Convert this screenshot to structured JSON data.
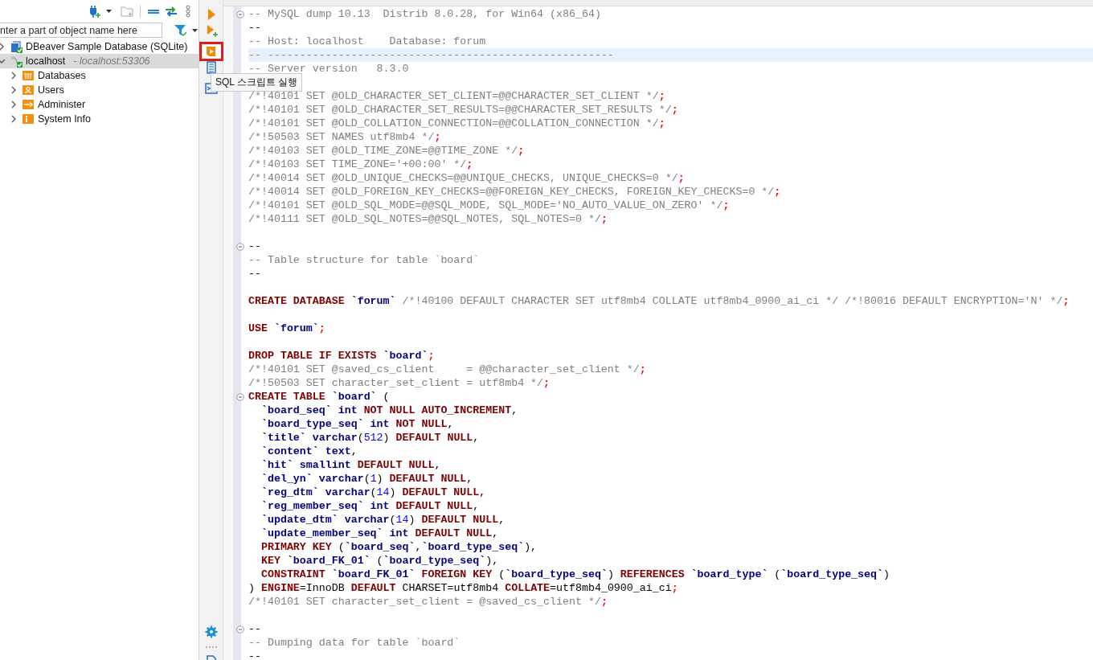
{
  "navigator": {
    "filter": {
      "placeholder": "nter a part of object name here"
    },
    "tree": [
      {
        "label": "DBeaver Sample Database (SQLite)",
        "kind": "database",
        "expanded": false,
        "selected": false
      },
      {
        "label": "localhost",
        "detail": "- localhost:53306",
        "kind": "connection",
        "expanded": true,
        "selected": true,
        "children": [
          {
            "label": "Databases",
            "kind": "databases",
            "expanded": false,
            "selected": false
          },
          {
            "label": "Users",
            "kind": "users",
            "expanded": false,
            "selected": false
          },
          {
            "label": "Administer",
            "kind": "admin",
            "expanded": false,
            "selected": false
          },
          {
            "label": "System Info",
            "kind": "info",
            "expanded": false,
            "selected": false
          }
        ]
      }
    ]
  },
  "editor_toolbar": [
    {
      "kind": "run",
      "highlighted": false
    },
    {
      "kind": "run-new",
      "highlighted": false
    },
    {
      "kind": "script",
      "highlighted": true
    },
    {
      "kind": "explain",
      "highlighted": false
    },
    {
      "kind": "terminal",
      "highlighted": false
    }
  ],
  "tooltip": {
    "text": "SQL 스크립트 실행"
  },
  "editor": {
    "lines": [
      {
        "fold": true,
        "tokens": [
          {
            "kind": "comment",
            "text": "-- MySQL dump 10.13  Distrib 8.0.28, for Win64 (x86_64)"
          }
        ]
      },
      {
        "tokens": [
          {
            "kind": "plain",
            "text": "--"
          }
        ]
      },
      {
        "tokens": [
          {
            "kind": "comment",
            "text": "-- Host: localhost    Database: forum"
          }
        ]
      },
      {
        "current": true,
        "tokens": [
          {
            "kind": "comment",
            "text": "-- ------------------------------------------------------"
          }
        ]
      },
      {
        "tokens": [
          {
            "kind": "comment",
            "text": "-- Server version   8.3.0"
          }
        ]
      },
      {
        "kind": "blank"
      },
      {
        "tokens": [
          {
            "kind": "comment",
            "text": "/*!40101 SET @OLD_CHARACTER_SET_CLIENT=@@CHARACTER_SET_CLIENT */"
          },
          {
            "kind": "semicolon",
            "text": ";"
          }
        ]
      },
      {
        "tokens": [
          {
            "kind": "comment",
            "text": "/*!40101 SET @OLD_CHARACTER_SET_RESULTS=@@CHARACTER_SET_RESULTS */"
          },
          {
            "kind": "semicolon",
            "text": ";"
          }
        ]
      },
      {
        "tokens": [
          {
            "kind": "comment",
            "text": "/*!40101 SET @OLD_COLLATION_CONNECTION=@@COLLATION_CONNECTION */"
          },
          {
            "kind": "semicolon",
            "text": ";"
          }
        ]
      },
      {
        "tokens": [
          {
            "kind": "comment",
            "text": "/*!50503 SET NAMES utf8mb4 */"
          },
          {
            "kind": "semicolon",
            "text": ";"
          }
        ]
      },
      {
        "tokens": [
          {
            "kind": "comment",
            "text": "/*!40103 SET @OLD_TIME_ZONE=@@TIME_ZONE */"
          },
          {
            "kind": "semicolon",
            "text": ";"
          }
        ]
      },
      {
        "tokens": [
          {
            "kind": "comment",
            "text": "/*!40103 SET TIME_ZONE='+00:00' */"
          },
          {
            "kind": "semicolon",
            "text": ";"
          }
        ]
      },
      {
        "tokens": [
          {
            "kind": "comment",
            "text": "/*!40014 SET @OLD_UNIQUE_CHECKS=@@UNIQUE_CHECKS, UNIQUE_CHECKS=0 */"
          },
          {
            "kind": "semicolon",
            "text": ";"
          }
        ]
      },
      {
        "tokens": [
          {
            "kind": "comment",
            "text": "/*!40014 SET @OLD_FOREIGN_KEY_CHECKS=@@FOREIGN_KEY_CHECKS, FOREIGN_KEY_CHECKS=0 */"
          },
          {
            "kind": "semicolon",
            "text": ";"
          }
        ]
      },
      {
        "tokens": [
          {
            "kind": "comment",
            "text": "/*!40101 SET @OLD_SQL_MODE=@@SQL_MODE, SQL_MODE='NO_AUTO_VALUE_ON_ZERO' */"
          },
          {
            "kind": "semicolon",
            "text": ";"
          }
        ]
      },
      {
        "tokens": [
          {
            "kind": "comment",
            "text": "/*!40111 SET @OLD_SQL_NOTES=@@SQL_NOTES, SQL_NOTES=0 */"
          },
          {
            "kind": "semicolon",
            "text": ";"
          }
        ]
      },
      {
        "kind": "blank"
      },
      {
        "fold": true,
        "tokens": [
          {
            "kind": "plain",
            "text": "--"
          }
        ]
      },
      {
        "tokens": [
          {
            "kind": "comment",
            "text": "-- Table structure for table `board`"
          }
        ]
      },
      {
        "tokens": [
          {
            "kind": "plain",
            "text": "--"
          }
        ]
      },
      {
        "kind": "blank"
      },
      {
        "tokens": [
          {
            "kind": "keyword",
            "text": "CREATE DATABASE "
          },
          {
            "kind": "name",
            "text": "`forum` "
          },
          {
            "kind": "comment",
            "text": "/*!40100 DEFAULT CHARACTER SET utf8mb4 COLLATE utf8mb4_0900_ai_ci */ /*!80016 DEFAULT ENCRYPTION='N' */"
          },
          {
            "kind": "semicolon",
            "text": ";"
          }
        ]
      },
      {
        "kind": "blank"
      },
      {
        "tokens": [
          {
            "kind": "keyword",
            "text": "USE "
          },
          {
            "kind": "name",
            "text": "`forum`"
          },
          {
            "kind": "semicolon",
            "text": ";"
          }
        ]
      },
      {
        "kind": "blank"
      },
      {
        "tokens": [
          {
            "kind": "keyword",
            "text": "DROP TABLE IF EXISTS "
          },
          {
            "kind": "name",
            "text": "`board`"
          },
          {
            "kind": "semicolon",
            "text": ";"
          }
        ]
      },
      {
        "tokens": [
          {
            "kind": "comment",
            "text": "/*!40101 SET @saved_cs_client     = @@character_set_client */"
          },
          {
            "kind": "semicolon",
            "text": ";"
          }
        ]
      },
      {
        "tokens": [
          {
            "kind": "comment",
            "text": "/*!50503 SET character_set_client = utf8mb4 */"
          },
          {
            "kind": "semicolon",
            "text": ";"
          }
        ]
      },
      {
        "fold": true,
        "tokens": [
          {
            "kind": "keyword",
            "text": "CREATE TABLE "
          },
          {
            "kind": "name",
            "text": "`board` "
          },
          {
            "kind": "plain",
            "text": "("
          }
        ]
      },
      {
        "tokens": [
          {
            "kind": "name",
            "text": "  `board_seq` int "
          },
          {
            "kind": "keyword",
            "text": "NOT NULL AUTO_INCREMENT"
          },
          {
            "kind": "plain",
            "text": ","
          }
        ]
      },
      {
        "tokens": [
          {
            "kind": "name",
            "text": "  `board_type_seq` int "
          },
          {
            "kind": "keyword",
            "text": "NOT NULL"
          },
          {
            "kind": "plain",
            "text": ","
          }
        ]
      },
      {
        "tokens": [
          {
            "kind": "name",
            "text": "  `title` varchar"
          },
          {
            "kind": "plain",
            "text": "("
          },
          {
            "kind": "number",
            "text": "512"
          },
          {
            "kind": "plain",
            "text": ") "
          },
          {
            "kind": "keyword",
            "text": "DEFAULT NULL"
          },
          {
            "kind": "plain",
            "text": ","
          }
        ]
      },
      {
        "tokens": [
          {
            "kind": "name",
            "text": "  `content` text"
          },
          {
            "kind": "plain",
            "text": ","
          }
        ]
      },
      {
        "tokens": [
          {
            "kind": "name",
            "text": "  `hit` smallint "
          },
          {
            "kind": "keyword",
            "text": "DEFAULT NULL"
          },
          {
            "kind": "plain",
            "text": ","
          }
        ]
      },
      {
        "tokens": [
          {
            "kind": "name",
            "text": "  `del_yn` varchar"
          },
          {
            "kind": "plain",
            "text": "("
          },
          {
            "kind": "number",
            "text": "1"
          },
          {
            "kind": "plain",
            "text": ") "
          },
          {
            "kind": "keyword",
            "text": "DEFAULT NULL"
          },
          {
            "kind": "plain",
            "text": ","
          }
        ]
      },
      {
        "tokens": [
          {
            "kind": "name",
            "text": "  `reg_dtm` varchar"
          },
          {
            "kind": "plain",
            "text": "("
          },
          {
            "kind": "number",
            "text": "14"
          },
          {
            "kind": "plain",
            "text": ") "
          },
          {
            "kind": "keyword",
            "text": "DEFAULT NULL"
          },
          {
            "kind": "plain",
            "text": ","
          }
        ]
      },
      {
        "tokens": [
          {
            "kind": "name",
            "text": "  `reg_member_seq` int "
          },
          {
            "kind": "keyword",
            "text": "DEFAULT NULL"
          },
          {
            "kind": "plain",
            "text": ","
          }
        ]
      },
      {
        "tokens": [
          {
            "kind": "name",
            "text": "  `update_dtm` varchar"
          },
          {
            "kind": "plain",
            "text": "("
          },
          {
            "kind": "number",
            "text": "14"
          },
          {
            "kind": "plain",
            "text": ") "
          },
          {
            "kind": "keyword",
            "text": "DEFAULT NULL"
          },
          {
            "kind": "plain",
            "text": ","
          }
        ]
      },
      {
        "tokens": [
          {
            "kind": "name",
            "text": "  `update_member_seq` int "
          },
          {
            "kind": "keyword",
            "text": "DEFAULT NULL"
          },
          {
            "kind": "plain",
            "text": ","
          }
        ]
      },
      {
        "tokens": [
          {
            "kind": "keyword",
            "text": "  PRIMARY KEY "
          },
          {
            "kind": "plain",
            "text": "("
          },
          {
            "kind": "name",
            "text": "`board_seq`"
          },
          {
            "kind": "plain",
            "text": ","
          },
          {
            "kind": "name",
            "text": "`board_type_seq`"
          },
          {
            "kind": "plain",
            "text": "),"
          }
        ]
      },
      {
        "tokens": [
          {
            "kind": "keyword",
            "text": "  KEY "
          },
          {
            "kind": "name",
            "text": "`board_FK_01` "
          },
          {
            "kind": "plain",
            "text": "("
          },
          {
            "kind": "name",
            "text": "`board_type_seq`"
          },
          {
            "kind": "plain",
            "text": "),"
          }
        ]
      },
      {
        "tokens": [
          {
            "kind": "keyword",
            "text": "  CONSTRAINT "
          },
          {
            "kind": "name",
            "text": "`board_FK_01` "
          },
          {
            "kind": "keyword",
            "text": "FOREIGN KEY "
          },
          {
            "kind": "plain",
            "text": "("
          },
          {
            "kind": "name",
            "text": "`board_type_seq`"
          },
          {
            "kind": "plain",
            "text": ") "
          },
          {
            "kind": "keyword",
            "text": "REFERENCES "
          },
          {
            "kind": "name",
            "text": "`board_type` "
          },
          {
            "kind": "plain",
            "text": "("
          },
          {
            "kind": "name",
            "text": "`board_type_seq`"
          },
          {
            "kind": "plain",
            "text": ")"
          }
        ]
      },
      {
        "tokens": [
          {
            "kind": "plain",
            "text": ") "
          },
          {
            "kind": "keyword",
            "text": "ENGINE"
          },
          {
            "kind": "plain",
            "text": "=InnoDB "
          },
          {
            "kind": "keyword",
            "text": "DEFAULT"
          },
          {
            "kind": "plain",
            "text": " CHARSET=utf8mb4 "
          },
          {
            "kind": "keyword",
            "text": "COLLATE"
          },
          {
            "kind": "plain",
            "text": "=utf8mb4_0900_ai_ci"
          },
          {
            "kind": "semicolon",
            "text": ";"
          }
        ]
      },
      {
        "tokens": [
          {
            "kind": "comment",
            "text": "/*!40101 SET character_set_client = @saved_cs_client */"
          },
          {
            "kind": "semicolon",
            "text": ";"
          }
        ]
      },
      {
        "kind": "blank"
      },
      {
        "fold": true,
        "tokens": [
          {
            "kind": "plain",
            "text": "--"
          }
        ]
      },
      {
        "tokens": [
          {
            "kind": "comment",
            "text": "-- Dumping data for table `board`"
          }
        ]
      },
      {
        "tokens": [
          {
            "kind": "plain",
            "text": "--"
          }
        ]
      }
    ]
  }
}
